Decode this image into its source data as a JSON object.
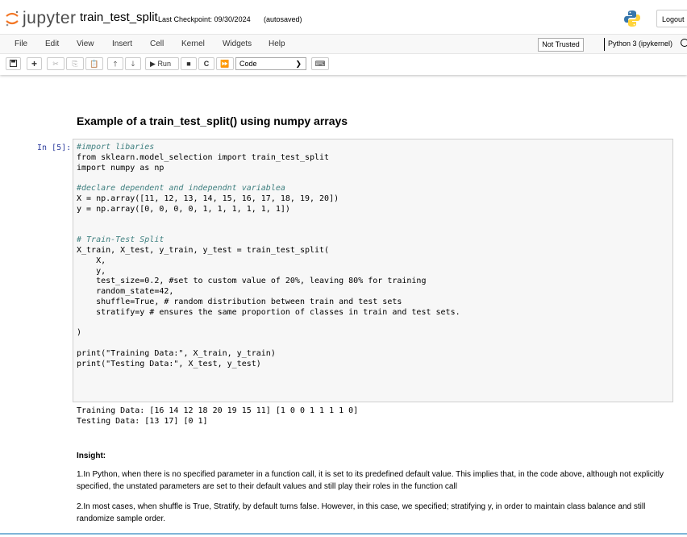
{
  "header": {
    "logo_text": "jupyter",
    "notebook_name": "train_test_split",
    "checkpoint": "Last Checkpoint: 09/30/2024",
    "autosave": "(autosaved)",
    "logout_label": "Logout"
  },
  "menu": {
    "items": [
      "File",
      "Edit",
      "View",
      "Insert",
      "Cell",
      "Kernel",
      "Widgets",
      "Help"
    ],
    "trusted": "Not Trusted",
    "kernel": "Python 3 (ipykernel)"
  },
  "toolbar": {
    "run_label": "Run",
    "cell_type": "Code"
  },
  "notebook": {
    "heading": "Example of a train_test_split() using numpy arrays",
    "prompt": "In [5]:",
    "code_lines": [
      "#import libaries",
      "from sklearn.model_selection import train_test_split",
      "import numpy as np",
      "",
      "#declare dependent and independnt variablea",
      "X = np.array([11, 12, 13, 14, 15, 16, 17, 18, 19, 20])",
      "y = np.array([0, 0, 0, 0, 1, 1, 1, 1, 1, 1])",
      "",
      "",
      "# Train-Test Split",
      "X_train, X_test, y_train, y_test = train_test_split(",
      "    X,",
      "    y,",
      "    test_size=0.2, #set to custom value of 20%, leaving 80% for training",
      "    random_state=42,",
      "    shuffle=True, # random distribution between train and test sets",
      "    stratify=y # ensures the same proportion of classes in train and test sets.",
      "",
      ")",
      "",
      "print(\"Training Data:\", X_train, y_train)",
      "print(\"Testing Data:\", X_test, y_test)"
    ],
    "output_lines": [
      "Training Data: [16 14 12 18 20 19 15 11] [1 0 0 1 1 1 1 0]",
      "Testing Data: [13 17] [0 1]"
    ],
    "insight_title": "Insight:",
    "insight_1": "1.In Python, when there is no specified parameter in a function call, it is set to its predefined default value. This implies that, in the code above, although not explicitly specified, the unstated parameters are set to their default values and still play their roles in the function call",
    "insight_2": "2.In most cases, when shuffle is True, Stratify, by default turns false. However, in this case, we specified; stratifying y, in order to maintain class balance and still randomize sample order."
  }
}
